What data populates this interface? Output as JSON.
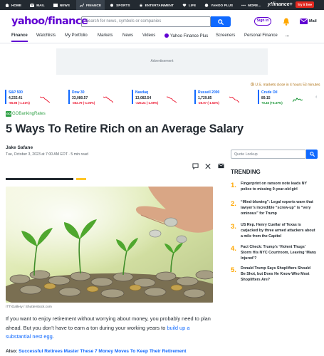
{
  "topnav": {
    "items": [
      "HOME",
      "MAIL",
      "NEWS",
      "FINANCE",
      "SPORTS",
      "ENTERTAINMENT",
      "LIFE",
      "YAHOO PLUS",
      "MORE..."
    ],
    "brand": "y!finance+",
    "cta": "Try it free"
  },
  "header": {
    "logo": "yahoo/finance",
    "search_placeholder": "Search for news, symbols or companies",
    "signin": "Sign in",
    "mail": "Mail"
  },
  "subnav": {
    "items": [
      "Finance",
      "Watchlists",
      "My Portfolio",
      "Markets",
      "News",
      "Videos",
      "Yahoo Finance Plus",
      "Screeners",
      "Personal Finance",
      "..."
    ]
  },
  "ad": {
    "label": "Advertisement"
  },
  "market_notice": "U.S. markets close in 4 hours 53 minutes",
  "tickers": [
    {
      "name": "S&P 500",
      "value": "4,232.41",
      "change": "-55.98 (-1.31%)",
      "direction": "down"
    },
    {
      "name": "Dow 30",
      "value": "33,080.57",
      "change": "-352.79 (-1.06%)",
      "direction": "down"
    },
    {
      "name": "Nasdaq",
      "value": "13,082.54",
      "change": "-225.24 (-1.69%)",
      "direction": "down"
    },
    {
      "name": "Russell 2000",
      "value": "1,729.85",
      "change": "-26.97 (-1.53%)",
      "direction": "down"
    },
    {
      "name": "Crude Oil",
      "value": "89.15",
      "change": "+0.33 (+0.37%)",
      "direction": "up"
    }
  ],
  "article": {
    "brand_logo": "GO",
    "brand": "GOBankingRates",
    "title": "5 Ways To Retire Rich on an Average Salary",
    "author": "Jake Safane",
    "meta": "Tue, October 3, 2023 at 7:00 AM EDT · 5 min read",
    "image_credit": "ITTIGallery / Shutterstock.com",
    "body_1": "If you want to enjoy retirement without worrying about money, you probably need to plan ahead. But you don’t have to earn a ton during your working years to ",
    "body_link": "build up a substantial nest egg",
    "body_2": ".",
    "also_label": "Also:",
    "also_link": "Successful Retirees Master These 7 Money Moves To Keep Their Retirement"
  },
  "sidebar": {
    "quote_placeholder": "Quote Lookup",
    "trending_title": "TRENDING",
    "trending": [
      {
        "num": "1.",
        "text": "Fingerprint on ransom note leads NY police to missing 9-year-old girl"
      },
      {
        "num": "2.",
        "text": "“Mind-blowing”: Legal experts warn that lawyer’s incredible “screw-up” is “very ominous” for Trump"
      },
      {
        "num": "3.",
        "text": "US Rep. Henry Cuellar of Texas is carjacked by three armed attackers about a mile from the Capitol"
      },
      {
        "num": "4.",
        "text": "Fact Check: Trump’s ‘Violent Thugs’ Storm His NYC Courtroom, Leaving ‘Many Injured’?"
      },
      {
        "num": "5.",
        "text": "Donald Trump Says Shoplifters Should Be Shot, but Does He Know Who Most Shoplifters Are?"
      }
    ]
  },
  "colors": {
    "brand_purple": "#6001d2",
    "link_blue": "#0f69ff",
    "down_red": "#eb0f29",
    "up_green": "#008a20",
    "trend_orange": "#ffa700"
  }
}
